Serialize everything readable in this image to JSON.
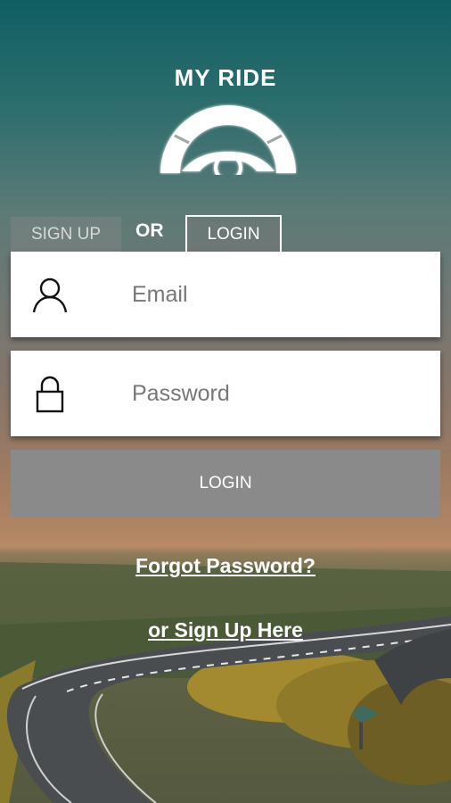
{
  "app": {
    "brand": "MY RIDE"
  },
  "tabs": {
    "signup_label": "SIGN UP",
    "or_label": "OR",
    "login_label": "LOGIN"
  },
  "form": {
    "email_placeholder": "Email",
    "password_placeholder": "Password",
    "login_button": "LOGIN"
  },
  "links": {
    "forgot_password": "Forgot Password?",
    "sign_up_here": "or Sign Up Here"
  },
  "icons": {
    "logo": "steering-wheel-icon",
    "email": "user-icon",
    "password": "lock-icon"
  },
  "colors": {
    "login_button": "#8a8a8a",
    "field_background": "#ffffff",
    "text_on_background": "#ffffff"
  }
}
